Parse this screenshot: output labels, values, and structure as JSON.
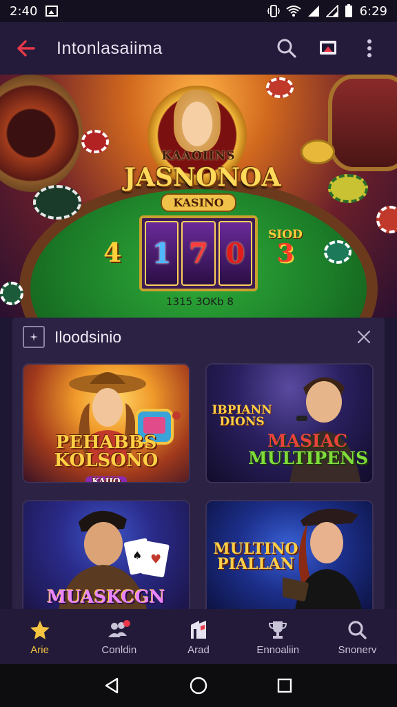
{
  "status_bar": {
    "time": "2:40",
    "clock": "6:29",
    "icons": [
      "image-icon",
      "vibrate-icon",
      "wifi-icon",
      "signal-icon",
      "signal-icon",
      "battery-icon"
    ]
  },
  "app_bar": {
    "title": "Intonlasaiima",
    "icons": [
      "back-arrow-icon",
      "search-icon",
      "cast-icon",
      "more-vert-icon"
    ],
    "accent": "#e8384a"
  },
  "hero": {
    "brand_top": "KAAOIINS",
    "brand_main": "JASNONOA",
    "brand_sub": "KASINO",
    "side_number": "4",
    "reels": [
      "1",
      "7",
      "0"
    ],
    "slot_label_top": "SIOD",
    "slot_label_number": "3",
    "table_text": "1315 3OKb 8"
  },
  "panel": {
    "title": "Iloodsinio",
    "icons": [
      "sparkle-icon",
      "close-icon"
    ],
    "cards": [
      {
        "title_line1": "PEHABBS",
        "title_line2": "KOLSONO",
        "subtitle": "KAIIO"
      },
      {
        "top_text_1": "IBPIANN",
        "top_text_2": "DIONS",
        "title_line1": "MASIAC",
        "title_line2": "MULTIPENS"
      },
      {
        "title_line1": "MUASKCGN"
      },
      {
        "title_line1": "MULTINO",
        "title_line2": "PIALLAN"
      }
    ]
  },
  "bottom_nav": {
    "active_color": "#f5c542",
    "items": [
      {
        "label": "Arie",
        "icon": "star-icon",
        "active": true
      },
      {
        "label": "Conldin",
        "icon": "users-icon",
        "active": false
      },
      {
        "label": "Arad",
        "icon": "building-icon",
        "active": false
      },
      {
        "label": "Ennoaliin",
        "icon": "trophy-icon",
        "active": false
      },
      {
        "label": "Snonerv",
        "icon": "search-icon",
        "active": false
      }
    ]
  },
  "system_nav": {
    "icons": [
      "back-triangle-icon",
      "home-circle-icon",
      "recents-square-icon"
    ]
  }
}
